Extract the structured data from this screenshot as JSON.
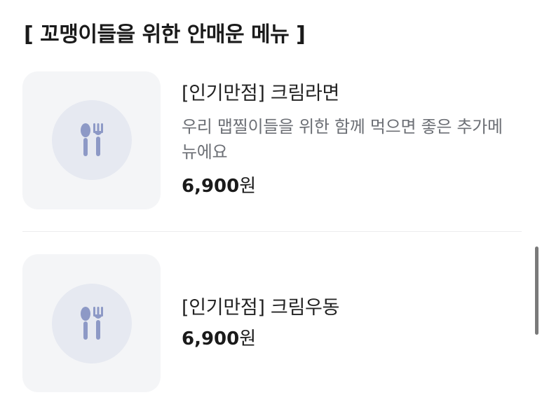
{
  "section": {
    "title": "[ 꼬맹이들을 위한 안매운 메뉴 ]"
  },
  "items": [
    {
      "name": "[인기만점] 크림라면",
      "description": "우리 맵찔이들을 위한 함께 먹으면 좋은 추가메뉴에요",
      "price": "6,900",
      "currency": "원",
      "icon": "utensils-icon"
    },
    {
      "name": "[인기만점] 크림우동",
      "description": "",
      "price": "6,900",
      "currency": "원",
      "icon": "utensils-icon"
    }
  ],
  "colors": {
    "thumb_bg": "#f4f5f7",
    "icon_circle": "#e6e9f1",
    "icon_fill": "#8d99c6",
    "description_text": "#6c6f75"
  }
}
